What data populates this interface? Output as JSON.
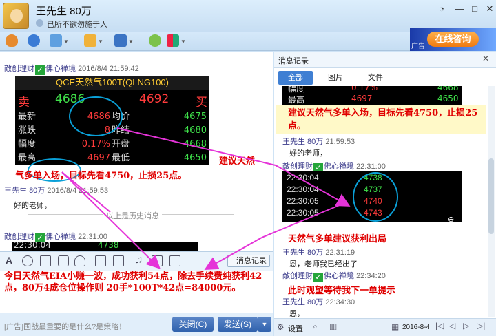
{
  "window": {
    "contact_name": "王先生 80万",
    "signature": "已所不欲勿施于人"
  },
  "ad": {
    "label": "广告",
    "button": "在线咨询"
  },
  "chat": {
    "msg1_sender": "敵创理财",
    "msg1_sender2": "佛心禅境",
    "msg1_time": "2016/8/4 21:59:42",
    "quote": {
      "title": "QCE天然气100T(QLNG100)",
      "sell": "卖",
      "sell_price": "4686",
      "buy_price": "4692",
      "buy": "买",
      "rows": [
        {
          "label": "最新",
          "value": "4686",
          "label2": "均价",
          "right": "4675"
        },
        {
          "label": "涨跌",
          "value": "8",
          "label2": "昨结",
          "right": "4680"
        },
        {
          "label": "幅度",
          "value": "0.17%",
          "label2": "开盘",
          "right": "4668"
        },
        {
          "label": "最高",
          "value": "4697",
          "label2": "最低",
          "right": "4650"
        }
      ]
    },
    "overlay_note1": "建议天然",
    "overlay_note2": "气多单入场，目标先看4750，止损25点。",
    "msg2_sender": "王先生",
    "msg2_sender2": "80万",
    "msg2_time": "2016/8/4 21:59:53",
    "msg2_text": "好的老师，",
    "history_sep": "以上是历史消息",
    "msg3_sender": "敵创理财",
    "msg3_sender2": "佛心禅境",
    "msg3_time": "22:31:00",
    "msg3_time_partial": "22:30:04",
    "msg3_val_partial": "4738",
    "overlay_summary": "今日天然气EIA小赚一波，成功获利54点，除去手续费纯获利42点，80万4成仓位操作则 20手*100T*42点=84000元。"
  },
  "input": {
    "history_button": "消息记录",
    "ad_text": "[广告]国战最重要的是什么?是策略！",
    "close_button": "关闭(C)",
    "send_button": "发送(S)"
  },
  "right": {
    "header": "消息记录",
    "tabs": [
      "全部",
      "图片",
      "文件"
    ],
    "top_rows": [
      {
        "label": "幅度",
        "value": "0.17%",
        "right": "4668"
      },
      {
        "label": "最高",
        "value": "4697",
        "right": "4650"
      }
    ],
    "note1": "建议天然气多单入场，目标先看4750，止损25点。",
    "r1_sender": "王先生 80万",
    "r1_time": "21:59:53",
    "r1_text": "好的老师，",
    "r2_sender": "敵创理财",
    "r2_sender2": "佛心禅境",
    "r2_time": "22:31:00",
    "ticks": [
      {
        "t": "22:30:04",
        "v": "4738"
      },
      {
        "t": "22:30:04",
        "v": "4737"
      },
      {
        "t": "22:30:05",
        "v": "4740"
      },
      {
        "t": "22:30:05",
        "v": "4743"
      }
    ],
    "note2": "天然气多单建议获利出局",
    "r3_sender": "王先生 80万",
    "r3_time": "22:31:19",
    "r3_text": "恩，老师我已经出了",
    "r4_sender": "敵创理财",
    "r4_sender2": "佛心禅境",
    "r4_time": "22:34:20",
    "note3": "此时观望等待我下一单提示",
    "r5_sender": "王先生 80万",
    "r5_time": "22:34:30",
    "r5_text": "恩，",
    "settings": "设置",
    "date": "2016-8-4"
  },
  "colors": {
    "up": "#ff3b3b",
    "down": "#3fe04a",
    "accent": "#3f7fd3",
    "annotation": "#e00000"
  }
}
